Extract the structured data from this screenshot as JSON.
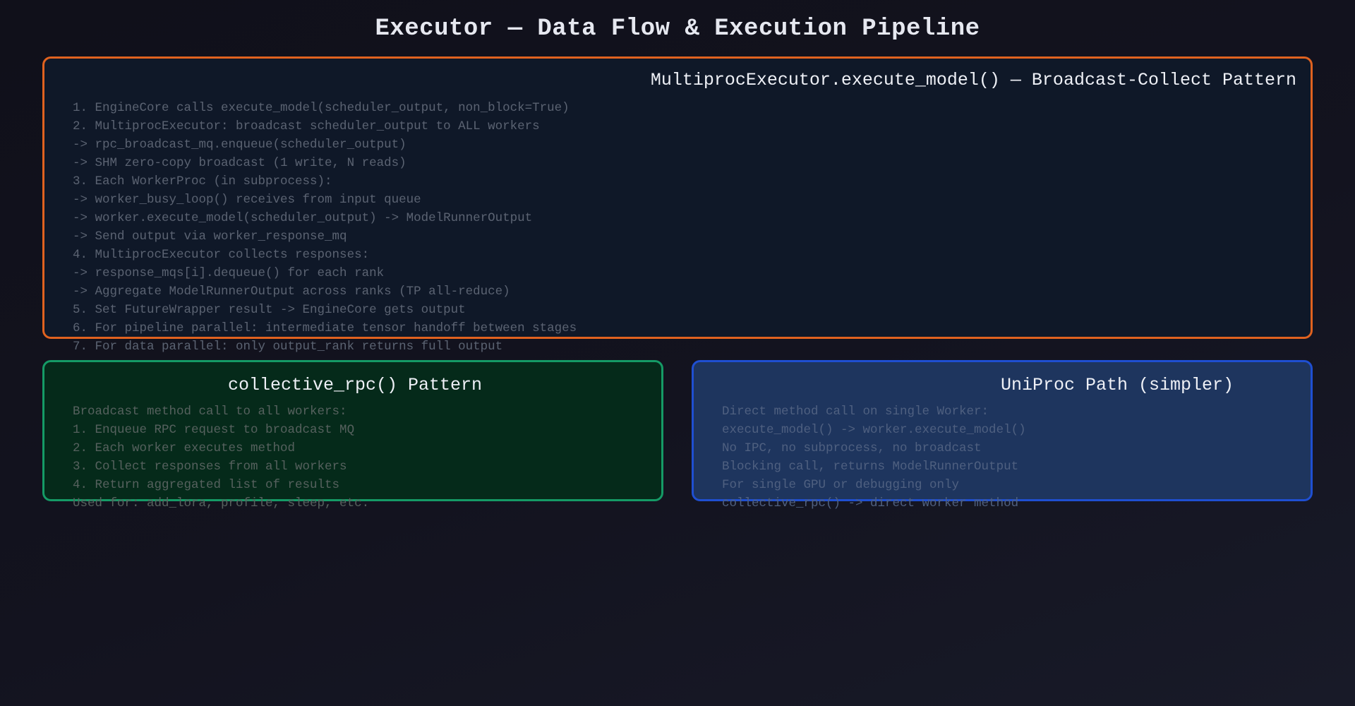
{
  "page": {
    "title": "Executor — Data Flow & Execution Pipeline"
  },
  "multiproc_panel": {
    "title": "MultiprocExecutor.execute_model() — Broadcast-Collect Pattern",
    "border_color": "#e0621f",
    "lines": [
      "1. EngineCore calls execute_model(scheduler_output, non_block=True)",
      "2. MultiprocExecutor: broadcast scheduler_output to ALL workers",
      "-> rpc_broadcast_mq.enqueue(scheduler_output)",
      "-> SHM zero-copy broadcast (1 write, N reads)",
      "3. Each WorkerProc (in subprocess):",
      "-> worker_busy_loop() receives from input queue",
      "-> worker.execute_model(scheduler_output) -> ModelRunnerOutput",
      "-> Send output via worker_response_mq",
      "4. MultiprocExecutor collects responses:",
      "-> response_mqs[i].dequeue() for each rank",
      "-> Aggregate ModelRunnerOutput across ranks (TP all-reduce)",
      "5. Set FutureWrapper result -> EngineCore gets output",
      "6. For pipeline parallel: intermediate tensor handoff between stages",
      "7. For data parallel: only output_rank returns full output"
    ]
  },
  "rpc_panel": {
    "title": "collective_rpc() Pattern",
    "border_color": "#159a66",
    "lines": [
      "Broadcast method call to all workers:",
      "1. Enqueue RPC request to broadcast MQ",
      "2. Each worker executes method",
      "3. Collect responses from all workers",
      "4. Return aggregated list of results",
      "Used for: add_lora, profile, sleep, etc."
    ]
  },
  "uniproc_panel": {
    "title": "UniProc Path (simpler)",
    "border_color": "#1f4fd1",
    "lines": [
      "Direct method call on single Worker:",
      "execute_model() -> worker.execute_model()",
      "No IPC, no subprocess, no broadcast",
      "Blocking call, returns ModelRunnerOutput",
      "For single GPU or debugging only",
      "collective_rpc() -> direct worker method"
    ]
  }
}
